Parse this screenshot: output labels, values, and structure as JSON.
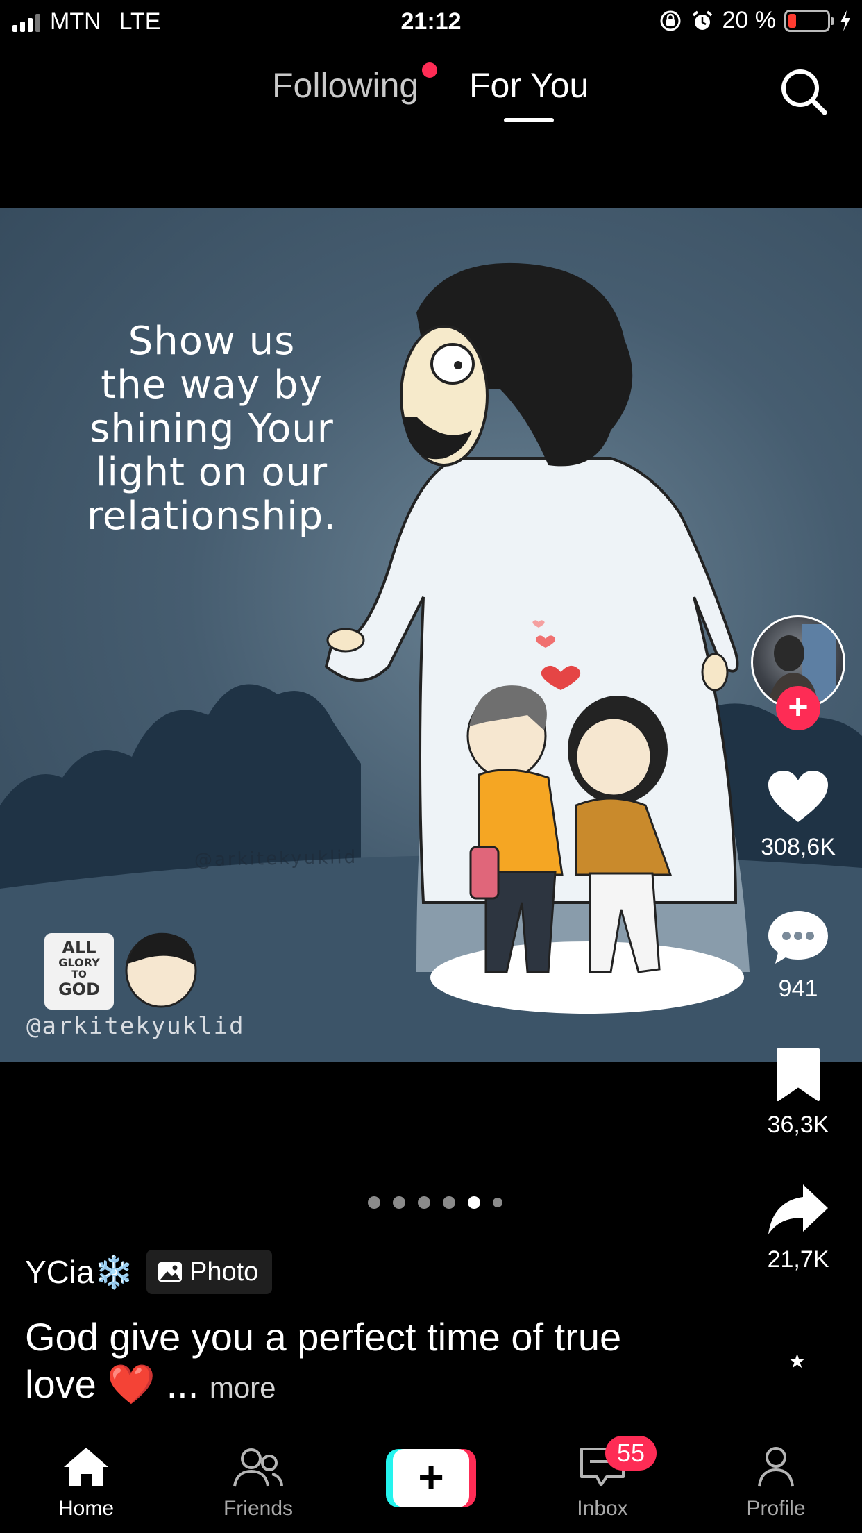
{
  "status_bar": {
    "carrier": "MTN",
    "network": "LTE",
    "time": "21:12",
    "battery_percent_label": "20 %",
    "battery_level": 0.2,
    "icons": [
      "signal-icon",
      "rotation-lock-icon",
      "alarm-icon",
      "battery-icon",
      "charging-icon"
    ]
  },
  "top_nav": {
    "following_label": "Following",
    "for_you_label": "For You",
    "active_tab": "For You",
    "following_has_update": true,
    "search_icon": "search-icon"
  },
  "photo": {
    "caption_lines": [
      "Show us",
      "the way by",
      "shining Your",
      "light on our",
      "relationship."
    ],
    "center_watermark": "@arkitekyuklid",
    "badge": {
      "line1": "ALL",
      "line2": "GLORY",
      "line3": "TO",
      "line4": "GOD"
    },
    "handle_watermark": "@arkitekyuklid"
  },
  "actions": {
    "likes": "308,6K",
    "comments": "941",
    "saves": "36,3K",
    "shares": "21,7K",
    "icons": [
      "avatar",
      "follow-plus-icon",
      "heart-icon",
      "comment-icon",
      "bookmark-icon",
      "share-icon"
    ]
  },
  "pager": {
    "total": 6,
    "active_index": 4
  },
  "post": {
    "author": "YCia❄️",
    "type_badge": "Photo",
    "caption": "God give you a perfect time of true love ❤️",
    "ellipsis": "...",
    "more_label": "more"
  },
  "tabbar": {
    "home": "Home",
    "friends": "Friends",
    "inbox": "Inbox",
    "profile": "Profile",
    "inbox_count": "55",
    "active": "Home"
  },
  "colors": {
    "accent": "#fe2c55",
    "create_cyan": "#25f4ee",
    "background": "#000000"
  }
}
